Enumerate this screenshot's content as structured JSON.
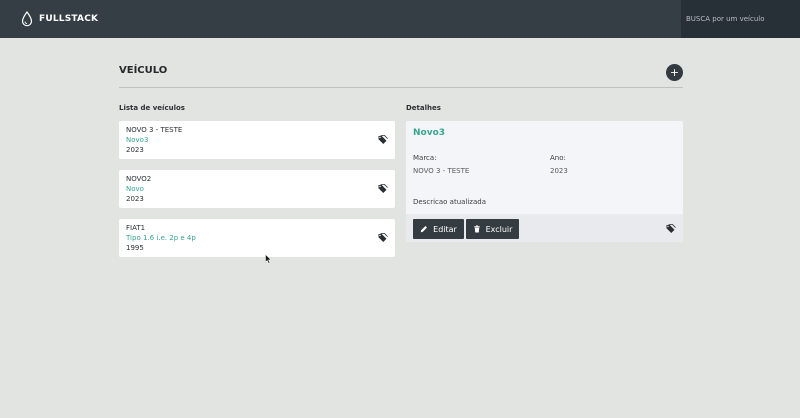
{
  "navbar": {
    "brand": "FULLSTACK",
    "search_placeholder": "BUSCA por um veículo"
  },
  "page": {
    "title": "VEÍCULO",
    "add_label": "+"
  },
  "list": {
    "label": "Lista de veículos",
    "items": [
      {
        "title": "NOVO 3 - TESTE",
        "subtitle": "Novo3",
        "year": "2023"
      },
      {
        "title": "NOVO2",
        "subtitle": "Novo",
        "year": "2023"
      },
      {
        "title": "FIAT1",
        "subtitle": "Tipo 1.6 i.e. 2p e 4p",
        "year": "1995"
      }
    ]
  },
  "details": {
    "label": "Detalhes",
    "title": "Novo3",
    "marca_label": "Marca:",
    "marca_value": "NOVO 3 - TESTE",
    "ano_label": "Ano:",
    "ano_value": "2023",
    "description": "Descricao atualizada",
    "edit_label": "Editar",
    "delete_label": "Excluir"
  },
  "colors": {
    "navbar": "#353e45",
    "accent_green": "#38a58f",
    "button_dark": "#353c41",
    "background": "#e2e4e1"
  },
  "icons": [
    "drop-logo-icon",
    "plus-icon",
    "tag-icon",
    "pencil-icon",
    "trash-icon",
    "mouse-cursor-icon"
  ]
}
